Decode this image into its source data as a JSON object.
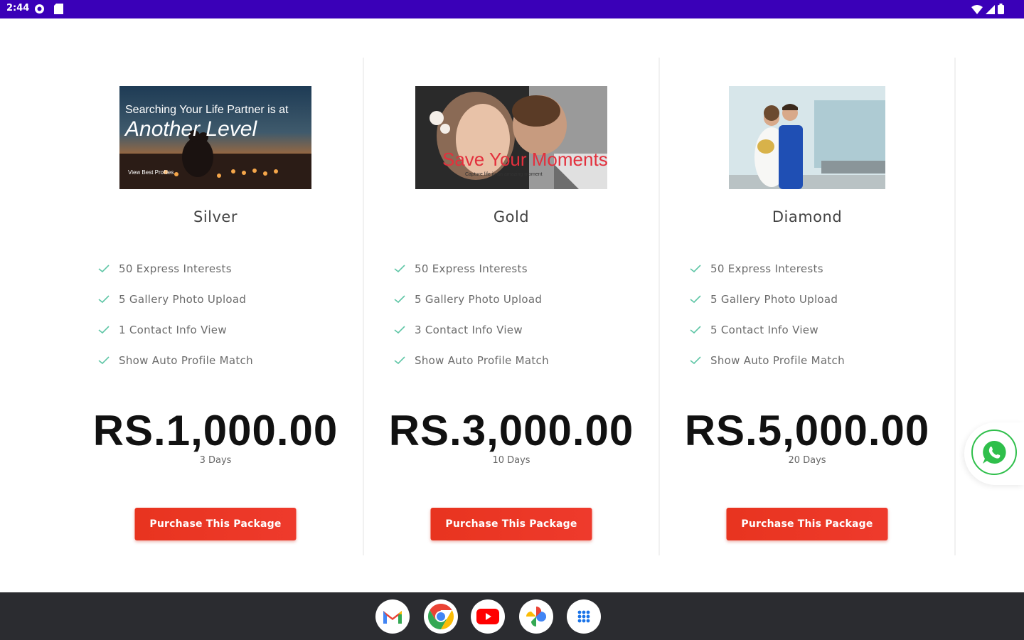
{
  "status_bar": {
    "time": "2:44",
    "icons": [
      "settings-status-icon",
      "sd-card-icon",
      "wifi-icon",
      "signal-icon",
      "battery-icon"
    ],
    "color": "#3a00b8"
  },
  "packages": [
    {
      "name": "Silver",
      "image": {
        "text_line1": "Searching Your Life Partner is at",
        "text_line2": "Another Level",
        "text_small": "View Best Profiles"
      },
      "features": [
        "50 Express Interests",
        "5 Gallery Photo Upload",
        "1 Contact Info View",
        "Show Auto Profile Match"
      ],
      "price": "RS.1,000.00",
      "duration": "3 Days",
      "button_label": "Purchase This Package"
    },
    {
      "name": "Gold",
      "image": {
        "text_line1": "Save Your Moments",
        "text_small": "Capture life in an amazing moment"
      },
      "features": [
        "50 Express Interests",
        "5 Gallery Photo Upload",
        "3 Contact Info View",
        "Show Auto Profile Match"
      ],
      "price": "RS.3,000.00",
      "duration": "10 Days",
      "button_label": "Purchase This Package"
    },
    {
      "name": "Diamond",
      "image": {},
      "features": [
        "50 Express Interests",
        "5 Gallery Photo Upload",
        "5 Contact Info View",
        "Show Auto Profile Match"
      ],
      "price": "RS.5,000.00",
      "duration": "20 Days",
      "button_label": "Purchase This Package"
    }
  ],
  "colors": {
    "accent_button": "#e8341f",
    "check": "#5fc6a6",
    "whatsapp": "#2fbf4b"
  },
  "dock": {
    "apps": [
      "gmail-icon",
      "chrome-icon",
      "youtube-icon",
      "google-photos-icon",
      "app-launcher-icon"
    ]
  }
}
